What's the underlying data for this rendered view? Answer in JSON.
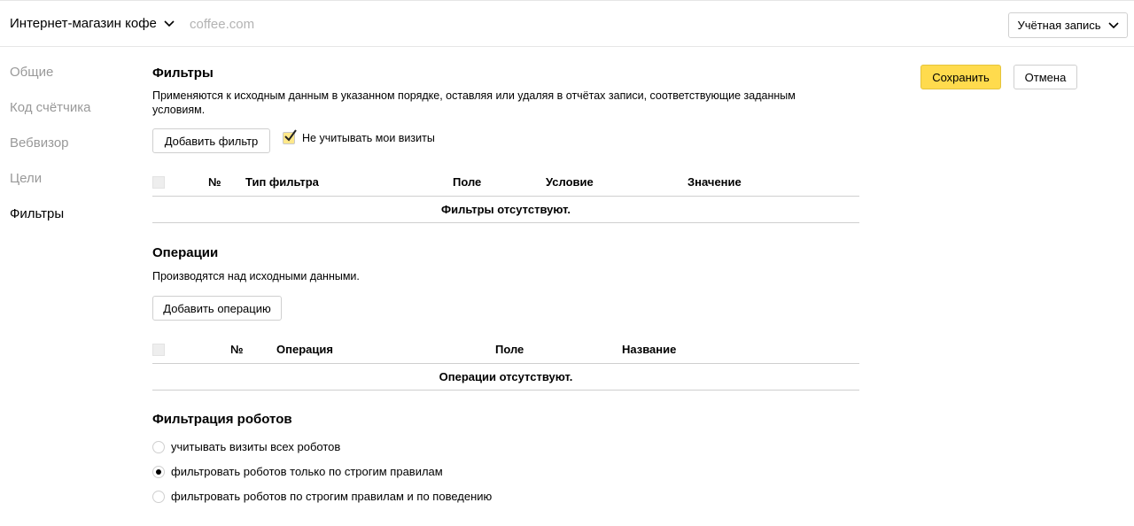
{
  "header": {
    "site_name": "Интернет-магазин кофе",
    "site_domain": "coffee.com",
    "account_label": "Учётная запись"
  },
  "nav": {
    "items": [
      {
        "label": "Общие",
        "active": false
      },
      {
        "label": "Код счётчика",
        "active": false
      },
      {
        "label": "Вебвизор",
        "active": false
      },
      {
        "label": "Цели",
        "active": false
      },
      {
        "label": "Фильтры",
        "active": true
      }
    ]
  },
  "actions": {
    "save_label": "Сохранить",
    "cancel_label": "Отмена"
  },
  "filters": {
    "title": "Фильтры",
    "description": "Применяются к исходным данным в указанном порядке, оставляя или удаляя в отчётах записи, соответствующие заданным условиям.",
    "add_label": "Добавить фильтр",
    "ignore_my_visits_label": "Не учитывать мои визиты",
    "ignore_my_visits_checked": true,
    "columns": [
      "№",
      "Тип фильтра",
      "Поле",
      "Условие",
      "Значение"
    ],
    "empty_text": "Фильтры отсутствуют."
  },
  "operations": {
    "title": "Операции",
    "description": "Производятся над исходными данными.",
    "add_label": "Добавить операцию",
    "columns": [
      "№",
      "Операция",
      "Поле",
      "Название"
    ],
    "empty_text": "Операции отсутствуют."
  },
  "robots": {
    "title": "Фильтрация роботов",
    "options": [
      {
        "label": "учитывать визиты всех роботов",
        "checked": false
      },
      {
        "label": "фильтровать роботов только по строгим правилам",
        "checked": true
      },
      {
        "label": "фильтровать роботов по строгим правилам и по поведению",
        "checked": false
      }
    ]
  },
  "colors": {
    "primary_button": "#ffdb4d",
    "checkbox_fill": "#ffe88a",
    "muted_text": "#999999"
  }
}
